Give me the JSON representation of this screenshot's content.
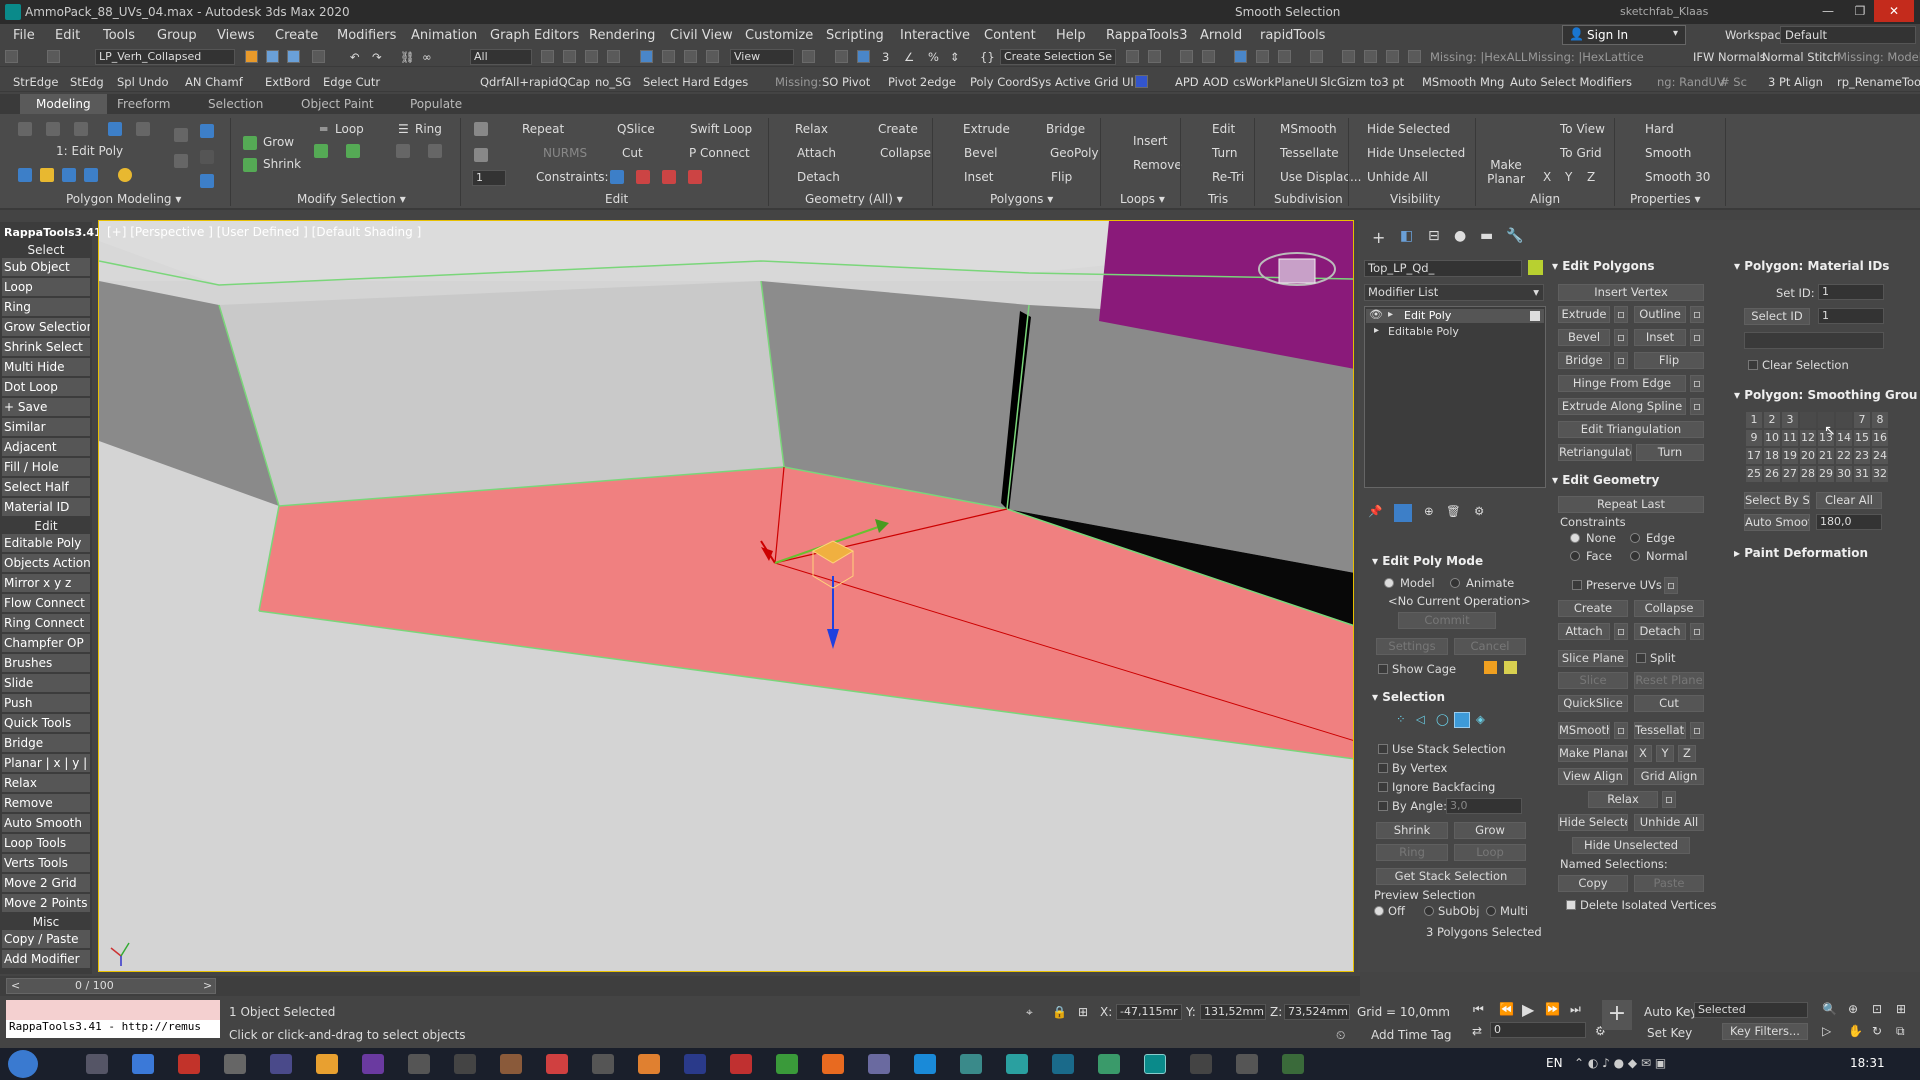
{
  "window": {
    "title": "AmmoPack_88_UVs_04.max - Autodesk 3ds Max 2020",
    "smooth_sel": "Smooth Selection",
    "sketchfab": "sketchfab_Klaas"
  },
  "menu": [
    "File",
    "Edit",
    "Tools",
    "Group",
    "Views",
    "Create",
    "Modifiers",
    "Animation",
    "Graph Editors",
    "Rendering",
    "Civil View",
    "Customize",
    "Scripting",
    "Interactive",
    "Content",
    "Help",
    "RappaTools3",
    "Arnold",
    "rapidTools"
  ],
  "signin": "Sign In",
  "workspaces_label": "Workspaces:",
  "workspace": "Default",
  "tb1": {
    "layer": "LP_Verh_Collapsed",
    "filter": "All",
    "view": "View",
    "create_sel": "Create Selection Se",
    "missing1": "Missing: |HexALL",
    "missing2": "Missing: |HexLattice",
    "ifw": "IFW Normals",
    "normal_stitch": "Normal Stitch",
    "missing3": "Missing: Modeling"
  },
  "tb2": [
    "StrEdge",
    "StEdg",
    "Spl Undo",
    "AN Chamf",
    "ExtBord",
    "Edge Cutr",
    "QdrfAll+",
    "rapidQCap",
    "no_SG",
    "Select Hard Edges",
    "Missing:",
    "SO Pivot",
    "Pivot 2edge",
    "Poly CoordSys",
    "Active Grid UI",
    "APD",
    "AOD",
    "csWorkPlaneUI",
    "SlcGizm to3 pt",
    "MSmooth Mng",
    "Auto Select Modifiers",
    "ng: RandUV",
    "# Sc",
    "3 Pt Align",
    "rp_RenameTools"
  ],
  "tabs": [
    "Modeling",
    "Freeform",
    "Selection",
    "Object Paint",
    "Populate"
  ],
  "ribbon": {
    "poly_label": "1: Edit Poly",
    "poly_section": "Polygon Modeling ▾",
    "grow": "Grow",
    "shrink": "Shrink",
    "loop": "Loop",
    "ring": "Ring",
    "modsel_section": "Modify Selection ▾",
    "repeat": "Repeat",
    "qslice": "QSlice",
    "swiftloop": "Swift Loop",
    "nurms": "NURMS",
    "cut": "Cut",
    "pconnect": "P Connect",
    "constraints": "Constraints:",
    "edit_section": "Edit",
    "relax": "Relax",
    "create": "Create",
    "attach": "Attach",
    "collapse": "Collapse",
    "detach": "Detach",
    "geom_section": "Geometry (All) ▾",
    "extrude": "Extrude",
    "bridge": "Bridge",
    "bevel": "Bevel",
    "geopoly": "GeoPoly",
    "inset": "Inset",
    "flip": "Flip",
    "polys_section": "Polygons ▾",
    "insert": "Insert",
    "remove": "Remove",
    "loops_section": "Loops ▾",
    "edit": "Edit",
    "turn": "Turn",
    "retri": "Re-Tri",
    "tris_section": "Tris",
    "msmooth": "MSmooth",
    "tessellate": "Tessellate",
    "usedisp": "Use Displac...",
    "subdiv_section": "Subdivision",
    "hidesel": "Hide Selected",
    "hideunsel": "Hide Unselected",
    "unhideall": "Unhide All",
    "vis_section": "Visibility",
    "makeplanar": "Make Planar",
    "toview": "To View",
    "togrid": "To Grid",
    "x": "X",
    "y": "Y",
    "z": "Z",
    "align_section": "Align",
    "hard": "Hard",
    "smooth": "Smooth",
    "smooth30": "Smooth 30",
    "props_section": "Properties ▾"
  },
  "left_panel": {
    "title": "RappaTools3.41",
    "items": [
      {
        "h": "Select"
      },
      {
        "t": "Sub Object"
      },
      {
        "t": "Loop"
      },
      {
        "t": "Ring"
      },
      {
        "t": "Grow Selection"
      },
      {
        "t": "Shrink Select"
      },
      {
        "t": "Multi Hide"
      },
      {
        "t": "Dot Loop"
      },
      {
        "t": "+ Save"
      },
      {
        "t": "Similar"
      },
      {
        "t": "Adjacent"
      },
      {
        "t": "Fill / Hole"
      },
      {
        "t": "Select Half"
      },
      {
        "t": "Material ID"
      },
      {
        "h": "Edit"
      },
      {
        "t": "Editable Poly"
      },
      {
        "t": "Objects Actions"
      },
      {
        "t": "Mirror   x  y  z"
      },
      {
        "t": "Flow Connect"
      },
      {
        "t": "Ring Connect"
      },
      {
        "t": "Champfer OP"
      },
      {
        "t": "Brushes"
      },
      {
        "t": "Slide"
      },
      {
        "t": "Push"
      },
      {
        "t": "Quick Tools"
      },
      {
        "t": "Bridge"
      },
      {
        "t": "Planar | x | y | z"
      },
      {
        "t": "Relax"
      },
      {
        "t": "Remove"
      },
      {
        "t": "Auto Smooth"
      },
      {
        "t": "Loop Tools"
      },
      {
        "t": "Verts Tools"
      },
      {
        "t": "Move 2 Grid"
      },
      {
        "t": "Move 2 Points"
      },
      {
        "h": "Misc"
      },
      {
        "t": "Copy / Paste"
      },
      {
        "t": "Add Modifier"
      }
    ]
  },
  "viewport": {
    "label": "[+] [Perspective ] [User Defined ] [Default Shading ]"
  },
  "cmd": {
    "obj_name": "Top_LP_Qd_",
    "modlist": "Modifier List",
    "stack": [
      "Edit Poly",
      "Editable Poly"
    ],
    "epm": "Edit Poly Mode",
    "model": "Model",
    "animate": "Animate",
    "noop": "<No Current Operation>",
    "commit": "Commit",
    "settings": "Settings",
    "cancel": "Cancel",
    "showcage": "Show Cage",
    "selection": "Selection",
    "use_stack": "Use Stack Selection",
    "byvertex": "By Vertex",
    "ignore_bf": "Ignore Backfacing",
    "byangle": "By Angle:",
    "angle_val": "3,0",
    "shrink": "Shrink",
    "grow": "Grow",
    "ring": "Ring",
    "loop": "Loop",
    "get_stack": "Get Stack Selection",
    "preview": "Preview Selection",
    "off": "Off",
    "subobj": "SubObj",
    "multi": "Multi",
    "polys_selected": "3 Polygons Selected",
    "edit_polys": "Edit Polygons",
    "insert_vertex": "Insert Vertex",
    "extrude": "Extrude",
    "outline": "Outline",
    "bevel": "Bevel",
    "inset": "Inset",
    "bridge": "Bridge",
    "flip": "Flip",
    "hinge": "Hinge From Edge",
    "extrude_spline": "Extrude Along Spline",
    "edit_tri": "Edit Triangulation",
    "retriangulate": "Retriangulate",
    "turn": "Turn",
    "edit_geom": "Edit Geometry",
    "repeat_last": "Repeat Last",
    "constraints": "Constraints",
    "none": "None",
    "edge": "Edge",
    "face": "Face",
    "normal": "Normal",
    "preserve_uvs": "Preserve UVs",
    "create": "Create",
    "collapse": "Collapse",
    "attach": "Attach",
    "detach": "Detach",
    "slice_plane": "Slice Plane",
    "split": "Split",
    "slice": "Slice",
    "reset_plane": "Reset Plane",
    "quickslice": "QuickSlice",
    "cut": "Cut",
    "msmooth": "MSmooth",
    "tessellate": "Tessellate",
    "make_planar": "Make Planar",
    "x": "X",
    "y": "Y",
    "z": "Z",
    "view_align": "View Align",
    "grid_align": "Grid Align",
    "relax": "Relax",
    "hide_sel": "Hide Selected",
    "unhide_all": "Unhide All",
    "hide_unsel": "Hide Unselected",
    "named_sel": "Named Selections:",
    "copy": "Copy",
    "paste": "Paste",
    "del_iso": "Delete Isolated Vertices",
    "mat_ids": "Polygon: Material IDs",
    "set_id": "Set ID:",
    "set_id_val": "1",
    "select_id": "Select ID",
    "select_id_val": "1",
    "clear_sel": "Clear Selection",
    "smooth_groups": "Polygon: Smoothing Grou",
    "sg": [
      "1",
      "2",
      "3",
      "",
      "",
      "",
      "7",
      "8",
      "9",
      "10",
      "11",
      "12",
      "13",
      "14",
      "15",
      "16",
      "17",
      "18",
      "19",
      "20",
      "21",
      "22",
      "23",
      "24",
      "25",
      "26",
      "27",
      "28",
      "29",
      "30",
      "31",
      "32"
    ],
    "select_by_sg": "Select By SG",
    "clear_all": "Clear All",
    "auto_smooth": "Auto Smooth",
    "auto_smooth_val": "180,0",
    "paint_def": "Paint Deformation"
  },
  "timeline": {
    "frame": "0 / 100"
  },
  "status": {
    "script": "RappaTools3.41 - http://remus",
    "selected": "1 Object Selected",
    "hint": "Click or click-and-drag to select objects",
    "x": "-47,115mr",
    "y": "131,52mm",
    "z": "73,524mm",
    "grid": "Grid = 10,0mm",
    "add_time_tag": "Add Time Tag",
    "auto_key": "Auto Key",
    "set_key": "Set Key",
    "selected_dd": "Selected",
    "key_filters": "Key Filters...",
    "frame_val": "0",
    "x_lbl": "X:",
    "y_lbl": "Y:",
    "z_lbl": "Z:"
  },
  "taskbar": {
    "lang": "EN",
    "time": "18:31"
  }
}
